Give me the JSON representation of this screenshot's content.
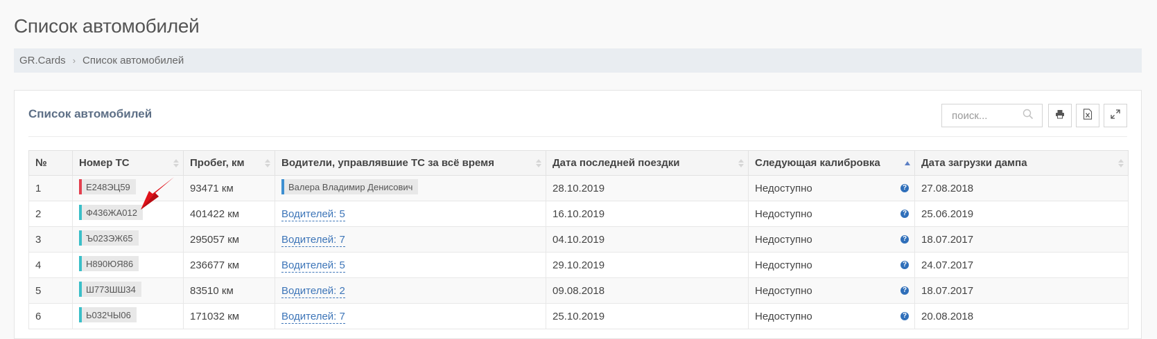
{
  "page": {
    "title": "Список автомобилей"
  },
  "breadcrumb": {
    "home": "GR.Cards",
    "current": "Список автомобилей"
  },
  "card": {
    "title": "Список автомобилей"
  },
  "toolbar": {
    "search_placeholder": "поиск...",
    "icons": [
      "search-icon",
      "print-icon",
      "excel-export-icon",
      "fullscreen-icon"
    ]
  },
  "table": {
    "columns": [
      "№",
      "Номер ТС",
      "Пробег, км",
      "Водители, управлявшие ТС за всё время",
      "Дата последней поездки",
      "Следующая калибровка",
      "Дата загрузки дампа"
    ],
    "sorted_column": "Следующая калибровка",
    "rows": [
      {
        "num": "1",
        "plate": "Е248ЭЦ59",
        "plate_color": "#e3404f",
        "mileage": "93471 км",
        "drivers": "Валера Владимир Денисович",
        "last_trip": "28.10.2019",
        "calibration": "Недоступно",
        "dump_date": "27.08.2018"
      },
      {
        "num": "2",
        "plate": "Ф436ЖА012",
        "plate_color": "#3bbfc8",
        "mileage": "401422 км",
        "drivers": "Водителей: 5",
        "last_trip": "16.10.2019",
        "calibration": "Недоступно",
        "dump_date": "25.06.2019"
      },
      {
        "num": "3",
        "plate": "Ъ023ЭЖ65",
        "plate_color": "#3bbfc8",
        "mileage": "295057 км",
        "drivers": "Водителей: 7",
        "last_trip": "04.10.2019",
        "calibration": "Недоступно",
        "dump_date": "18.07.2017"
      },
      {
        "num": "4",
        "plate": "Н890ЮЯ86",
        "plate_color": "#3bbfc8",
        "mileage": "236677 км",
        "drivers": "Водителей: 5",
        "last_trip": "29.10.2019",
        "calibration": "Недоступно",
        "dump_date": "24.07.2017"
      },
      {
        "num": "5",
        "plate": "Ш773ШШ34",
        "plate_color": "#3bbfc8",
        "mileage": "83510 км",
        "drivers": "Водителей: 2",
        "last_trip": "09.08.2018",
        "calibration": "Недоступно",
        "dump_date": "18.07.2017"
      },
      {
        "num": "6",
        "plate": "Ь032ЧЫ06",
        "plate_color": "#3bbfc8",
        "mileage": "171032 км",
        "drivers": "Водителей: 7",
        "last_trip": "25.10.2019",
        "calibration": "Недоступно",
        "dump_date": "20.08.2018"
      }
    ]
  },
  "colors": {
    "accent": "#3d75b8",
    "card_title": "#5d6f86",
    "annotation_arrow": "#e0121a"
  }
}
